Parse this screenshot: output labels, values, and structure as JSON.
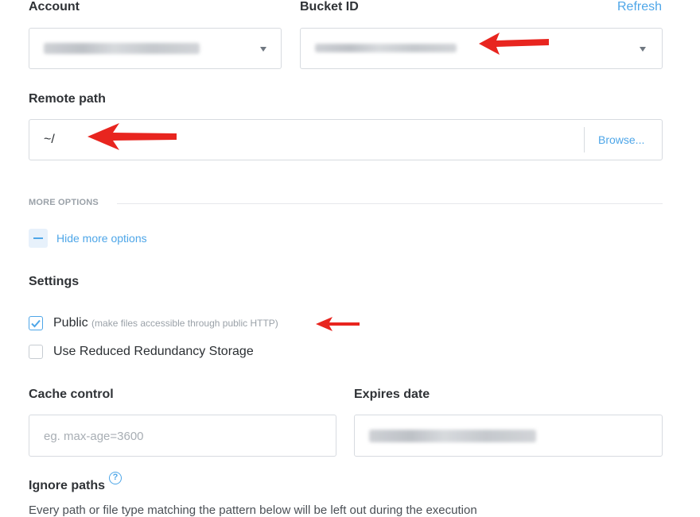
{
  "account": {
    "label": "Account",
    "value_obscured": true
  },
  "bucket": {
    "label": "Bucket ID",
    "refresh_label": "Refresh",
    "value_obscured": true
  },
  "remote_path": {
    "label": "Remote path",
    "value": "~/",
    "browse_label": "Browse..."
  },
  "more_options": {
    "section_label": "MORE OPTIONS",
    "toggle_label": "Hide more options"
  },
  "settings": {
    "label": "Settings",
    "public_label": "Public",
    "public_hint": "(make files accessible through public HTTP)",
    "public_checked": true,
    "rrs_label": "Use Reduced Redundancy Storage",
    "rrs_checked": false
  },
  "cache_control": {
    "label": "Cache control",
    "placeholder": "eg. max-age=3600"
  },
  "expires": {
    "label": "Expires date",
    "value_obscured": true
  },
  "ignore_paths": {
    "label": "Ignore paths",
    "help_icon": "?",
    "description": "Every path or file type matching the pattern below will be left out during the execution"
  },
  "colors": {
    "accent": "#4ea6e8",
    "arrow": "#e8251f",
    "border": "#d7dbe0"
  }
}
